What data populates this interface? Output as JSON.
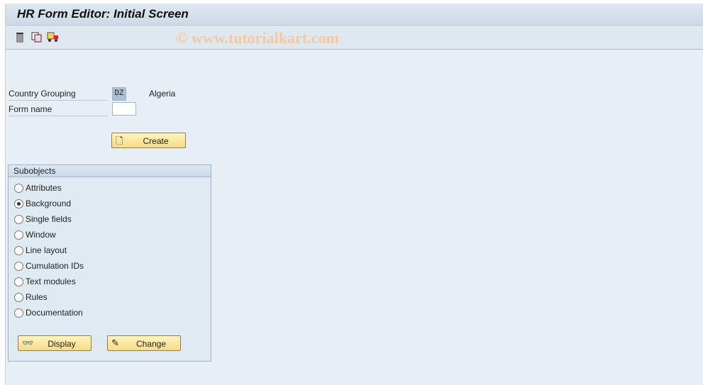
{
  "title": "HR Form Editor: Initial Screen",
  "toolbar": {
    "icons": [
      "trash-icon",
      "copy-icon",
      "transport-icon"
    ]
  },
  "watermark": "© www.tutorialkart.com",
  "form": {
    "country_label": "Country Grouping",
    "country_value": "DZ",
    "country_text": "Algeria",
    "form_label": "Form name",
    "form_value": ""
  },
  "create_label": "Create",
  "subobjects": {
    "title": "Subobjects",
    "selected": 1,
    "options": [
      "Attributes",
      "Background",
      "Single fields",
      "Window",
      "Line layout",
      "Cumulation IDs",
      "Text modules",
      "Rules",
      "Documentation"
    ]
  },
  "display_label": "Display",
  "change_label": "Change"
}
